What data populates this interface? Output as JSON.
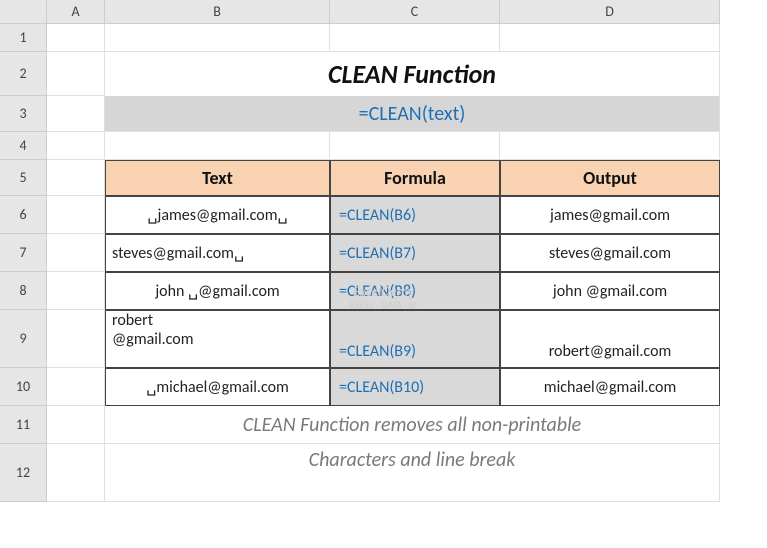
{
  "cols": [
    "A",
    "B",
    "C",
    "D"
  ],
  "colWidths": {
    "A": 58,
    "B": 225,
    "C": 170,
    "D": 220
  },
  "rows": [
    1,
    2,
    3,
    4,
    5,
    6,
    7,
    8,
    9,
    10,
    11,
    12
  ],
  "rowHeights": {
    "1": 28,
    "2": 44,
    "3": 36,
    "4": 28,
    "5": 36,
    "6": 38,
    "7": 38,
    "8": 38,
    "9": 58,
    "10": 38,
    "11": 38,
    "12": 58
  },
  "title": "CLEAN Function",
  "syntax": "=CLEAN(text)",
  "headers": {
    "text": "Text",
    "formula": "Formula",
    "output": "Output"
  },
  "data": [
    {
      "text": "␣james@gmail.com␣",
      "formula": "=CLEAN(B6)",
      "output": "james@gmail.com"
    },
    {
      "text": "steves@gmail.com␣",
      "formula": "=CLEAN(B7)",
      "output": "steves@gmail.com"
    },
    {
      "text": "john ␣@gmail.com",
      "formula": "=CLEAN(B8)",
      "output": "john @gmail.com"
    },
    {
      "text_line1": "robert",
      "text_line2": "@gmail.com",
      "formula": "=CLEAN(B9)",
      "output": "robert@gmail.com"
    },
    {
      "text": "␣michael@gmail.com",
      "formula": "=CLEAN(B10)",
      "output": "michael@gmail.com"
    }
  ],
  "footnote_line1": "CLEAN Function removes all non-printable",
  "footnote_line2": "Characters and line break",
  "watermark_line1": "ExcelDemy",
  "watermark_line2": "EXCEL · DATA · BI"
}
